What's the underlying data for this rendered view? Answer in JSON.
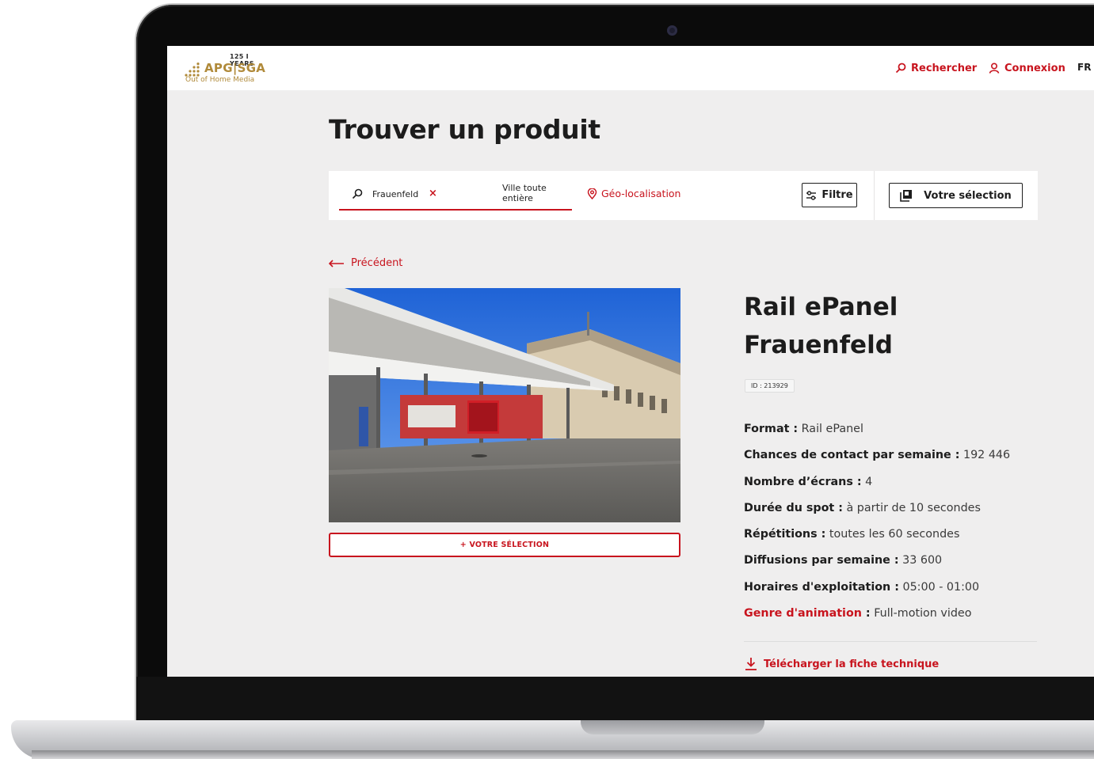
{
  "header": {
    "logo": {
      "years": "125 I YEARS",
      "brand": "APG|SGA",
      "tagline": "Out of Home Media"
    },
    "nav": {
      "search_label": "Rechercher",
      "login_label": "Connexion",
      "language": "FR"
    }
  },
  "page": {
    "title": "Trouver un produit"
  },
  "search": {
    "query": "Frauenfeld",
    "clear_symbol": "×",
    "scope": "Ville toute entière",
    "geo_label": "Géo-localisation",
    "filter_label": "Filtre",
    "selection_label": "Votre sélection"
  },
  "back_label": "Précédent",
  "product": {
    "title": "Rail ePanel Frauenfeld",
    "id_label": "ID : 213929",
    "add_button": "+ VOTRE SÉLECTION",
    "specs": [
      {
        "label": "Format :",
        "value": " Rail ePanel"
      },
      {
        "label": "Chances de contact par semaine :",
        "value": " 192 446"
      },
      {
        "label": "Nombre d’écrans :",
        "value": " 4"
      },
      {
        "label": "Durée du spot :",
        "value": " à partir de 10 secondes"
      },
      {
        "label": "Répétitions :",
        "value": " toutes les 60 secondes"
      },
      {
        "label": "Diffusions par semaine :",
        "value": " 33 600"
      },
      {
        "label": "Horaires d'exploitation :",
        "value": " 05:00 - 01:00"
      },
      {
        "label": "Genre d'animation",
        "label_suffix": " :",
        "value": " Full-motion video"
      }
    ],
    "download_label": "Télécharger la fiche technique"
  },
  "colors": {
    "accent": "#c8141e",
    "background": "#efeeee",
    "gold": "#b08a3a"
  }
}
